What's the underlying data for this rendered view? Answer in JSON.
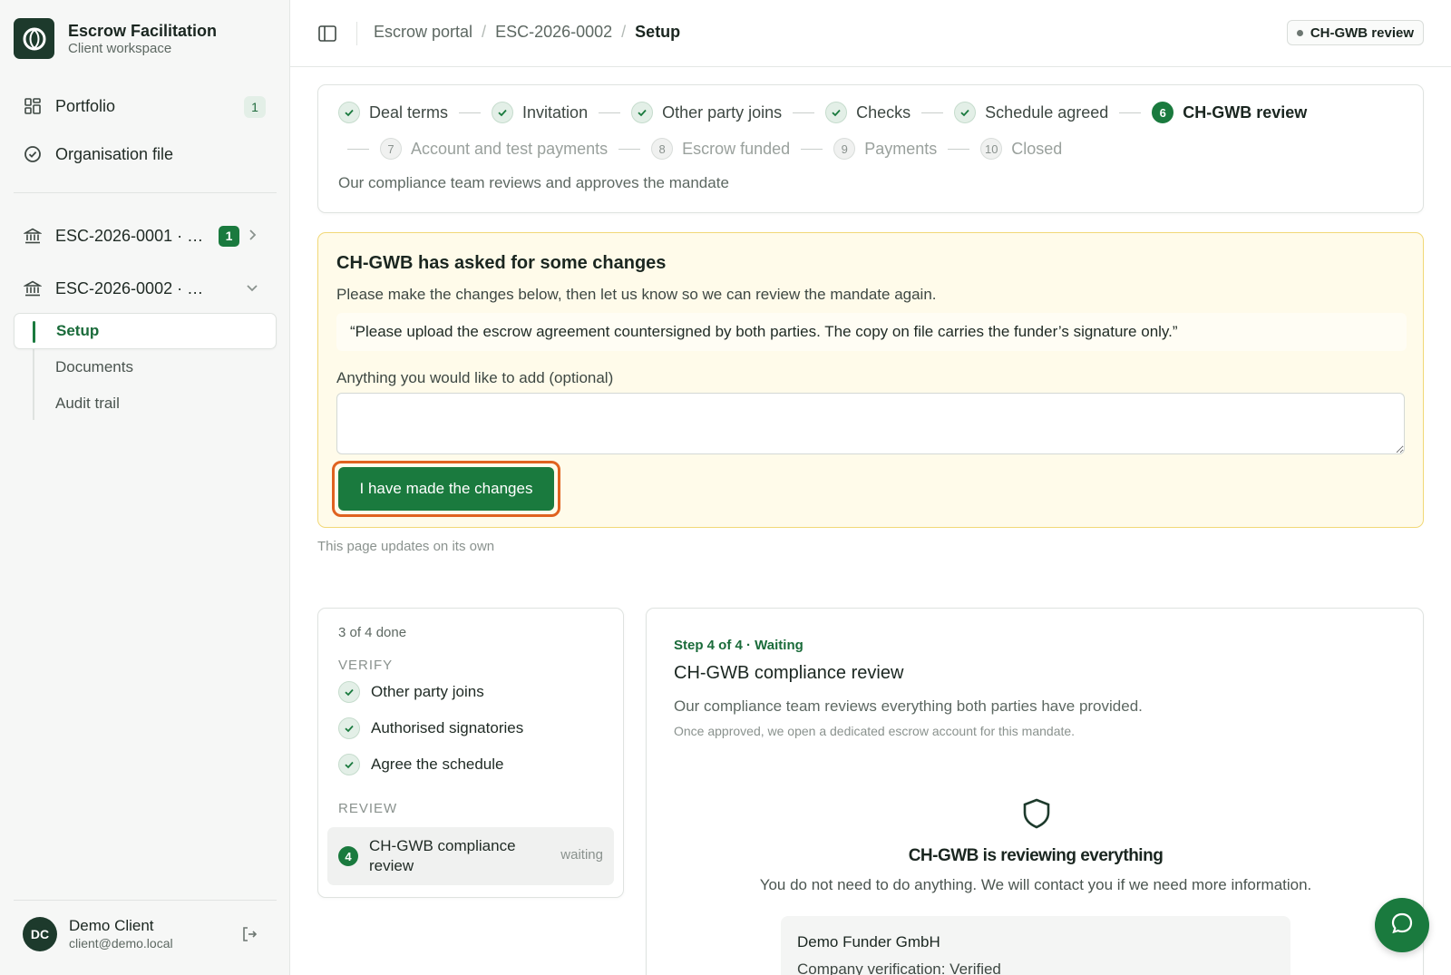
{
  "app": {
    "title": "Escrow Facilitation",
    "subtitle": "Client workspace"
  },
  "sidebar": {
    "portfolio_label": "Portfolio",
    "portfolio_count": "1",
    "org_file_label": "Organisation file",
    "escrows": [
      {
        "label": "ESC-2026-0001 · D...",
        "badge": "1"
      },
      {
        "label": "ESC-2026-0002 · Dem..."
      }
    ],
    "subnav": [
      "Setup",
      "Documents",
      "Audit trail"
    ],
    "user": {
      "initials": "DC",
      "name": "Demo Client",
      "email": "client@demo.local"
    }
  },
  "topbar": {
    "breadcrumb": [
      "Escrow portal",
      "ESC-2026-0002",
      "Setup"
    ],
    "status": "CH-GWB review"
  },
  "stepper": {
    "row1": [
      {
        "label": "Deal terms",
        "state": "done"
      },
      {
        "label": "Invitation",
        "state": "done"
      },
      {
        "label": "Other party joins",
        "state": "done"
      },
      {
        "label": "Checks",
        "state": "done"
      },
      {
        "label": "Schedule agreed",
        "state": "done"
      },
      {
        "num": "6",
        "label": "CH-GWB review",
        "state": "current"
      }
    ],
    "row2": [
      {
        "num": "7",
        "label": "Account and test payments",
        "state": "future"
      },
      {
        "num": "8",
        "label": "Escrow funded",
        "state": "future"
      },
      {
        "num": "9",
        "label": "Payments",
        "state": "future"
      },
      {
        "num": "10",
        "label": "Closed",
        "state": "future"
      }
    ],
    "description": "Our compliance team reviews and approves the mandate"
  },
  "changes": {
    "title": "CH-GWB has asked for some changes",
    "lead": "Please make the changes below, then let us know so we can review the mandate again.",
    "quote": "“Please upload the escrow agreement countersigned by both parties. The copy on file carries the funder’s signature only.”",
    "comment_label": "Anything you would like to add (optional)",
    "comment_value": "",
    "button": "I have made the changes"
  },
  "auto_update_note": "This page updates on its own",
  "checklist": {
    "progress": "3 of 4 done",
    "sections": [
      {
        "title": "VERIFY",
        "items": [
          "Other party joins",
          "Authorised signatories",
          "Agree the schedule"
        ]
      },
      {
        "title": "REVIEW",
        "items": [
          {
            "num": "4",
            "label": "CH-GWB compliance review",
            "status": "waiting"
          }
        ]
      }
    ]
  },
  "detail": {
    "eyebrow": "Step 4 of 4 · Waiting",
    "title": "CH-GWB compliance review",
    "description": "Our compliance team reviews everything both parties have provided.",
    "note": "Once approved, we open a dedicated escrow account for this mandate.",
    "heading": "CH-GWB is reviewing everything",
    "subtext": "You do not need to do anything. We will contact you if we need more information.",
    "party": {
      "name": "Demo Funder GmbH",
      "verification": "Company verification: Verified"
    }
  },
  "colors": {
    "brand_green": "#1a7a3e",
    "dark_green": "#1d3a2c",
    "warning_bg": "#fffbea",
    "warning_border": "#f1d877",
    "focus_ring": "#e0621f"
  },
  "icons": [
    "logo-icon",
    "grid-icon",
    "check-circle-icon",
    "bank-icon",
    "chevron-right-icon",
    "chevron-down-icon",
    "panel-toggle-icon",
    "check-icon",
    "shield-icon",
    "logout-icon",
    "chat-icon"
  ]
}
